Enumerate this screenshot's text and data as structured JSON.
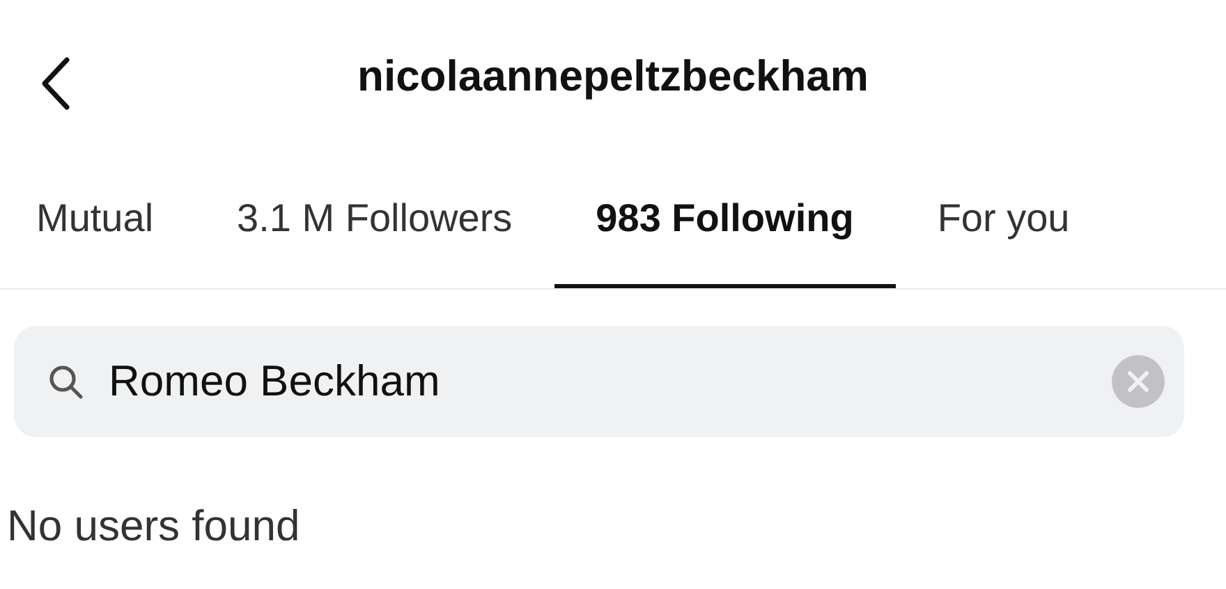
{
  "header": {
    "title": "nicolaannepeltzbeckham"
  },
  "tabs": [
    {
      "label": "Mutual",
      "selected": false
    },
    {
      "label": "3.1 M Followers",
      "selected": false
    },
    {
      "label": "983 Following",
      "selected": true
    },
    {
      "label": "For you",
      "selected": false
    }
  ],
  "search": {
    "value": "Romeo Beckham"
  },
  "empty_message": "No users found"
}
